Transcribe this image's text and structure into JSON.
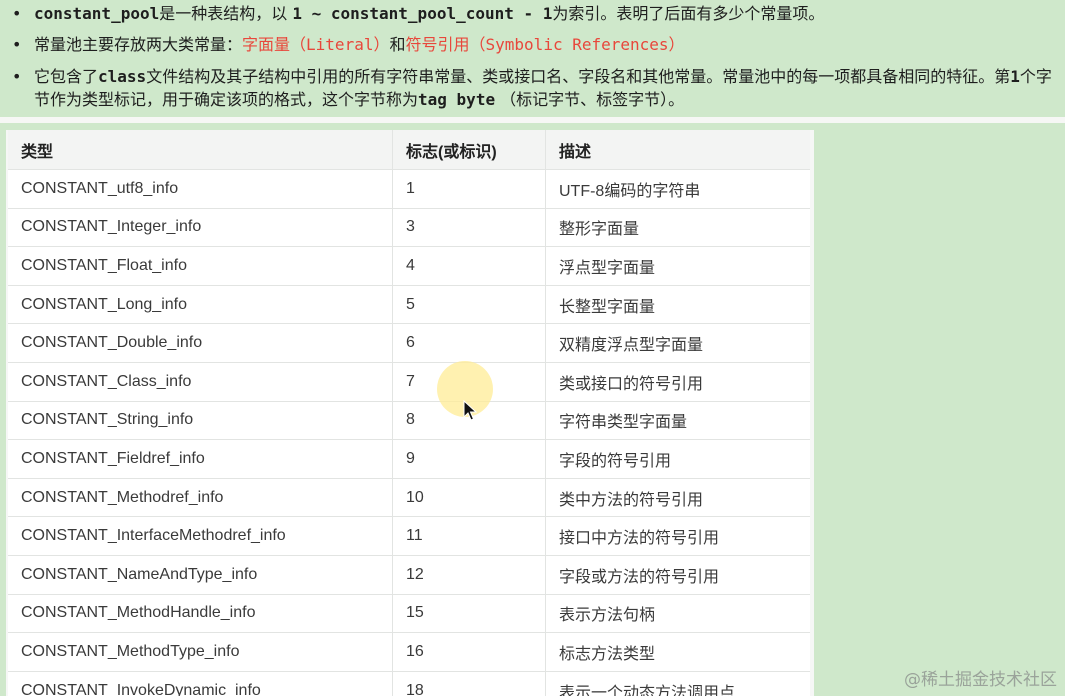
{
  "notes": [
    {
      "parts": [
        {
          "t": "constant_pool",
          "s": "mono"
        },
        {
          "t": "是一种表结构，以 ",
          "s": ""
        },
        {
          "t": "1 ~ constant_pool_count - 1",
          "s": "mono"
        },
        {
          "t": "为索引。表明了后面有多少个常量项。",
          "s": ""
        }
      ]
    },
    {
      "parts": [
        {
          "t": "常量池主要存放两大类常量：",
          "s": ""
        },
        {
          "t": "字面量（",
          "s": "red"
        },
        {
          "t": "Literal",
          "s": "red mono"
        },
        {
          "t": "）",
          "s": "red"
        },
        {
          "t": "和",
          "s": ""
        },
        {
          "t": "符号引用（",
          "s": "red"
        },
        {
          "t": "Symbolic References",
          "s": "red mono"
        },
        {
          "t": "）",
          "s": "red"
        }
      ]
    },
    {
      "parts": [
        {
          "t": "它包含了",
          "s": ""
        },
        {
          "t": "class",
          "s": "mono"
        },
        {
          "t": "文件结构及其子结构中引用的所有字符串常量、类或接口名、字段名和其他常量。常量池中的每一项都具备相同的特征。第",
          "s": ""
        },
        {
          "t": "1",
          "s": "mono"
        },
        {
          "t": "个字节作为类型标记，用于确定该项的格式，这个字节称为",
          "s": ""
        },
        {
          "t": "tag byte",
          "s": "mono"
        },
        {
          "t": " （标记字节、标签字节）。",
          "s": ""
        }
      ]
    }
  ],
  "table": {
    "headers": [
      "类型",
      "标志(或标识)",
      "描述"
    ],
    "rows": [
      [
        "CONSTANT_utf8_info",
        "1",
        "UTF-8编码的字符串"
      ],
      [
        "CONSTANT_Integer_info",
        "3",
        "整形字面量"
      ],
      [
        "CONSTANT_Float_info",
        "4",
        "浮点型字面量"
      ],
      [
        "CONSTANT_Long_info",
        "5",
        "长整型字面量"
      ],
      [
        "CONSTANT_Double_info",
        "6",
        "双精度浮点型字面量"
      ],
      [
        "CONSTANT_Class_info",
        "7",
        "类或接口的符号引用"
      ],
      [
        "CONSTANT_String_info",
        "8",
        "字符串类型字面量"
      ],
      [
        "CONSTANT_Fieldref_info",
        "9",
        "字段的符号引用"
      ],
      [
        "CONSTANT_Methodref_info",
        "10",
        "类中方法的符号引用"
      ],
      [
        "CONSTANT_InterfaceMethodref_info",
        "11",
        "接口中方法的符号引用"
      ],
      [
        "CONSTANT_NameAndType_info",
        "12",
        "字段或方法的符号引用"
      ],
      [
        "CONSTANT_MethodHandle_info",
        "15",
        "表示方法句柄"
      ],
      [
        "CONSTANT_MethodType_info",
        "16",
        "标志方法类型"
      ],
      [
        "CONSTANT_InvokeDynamic_info",
        "18",
        "表示一个动态方法调用点"
      ]
    ]
  },
  "watermark": "@稀土掘金技术社区",
  "colors": {
    "background": "#cfe8cb",
    "highlight": "#e8473b"
  }
}
